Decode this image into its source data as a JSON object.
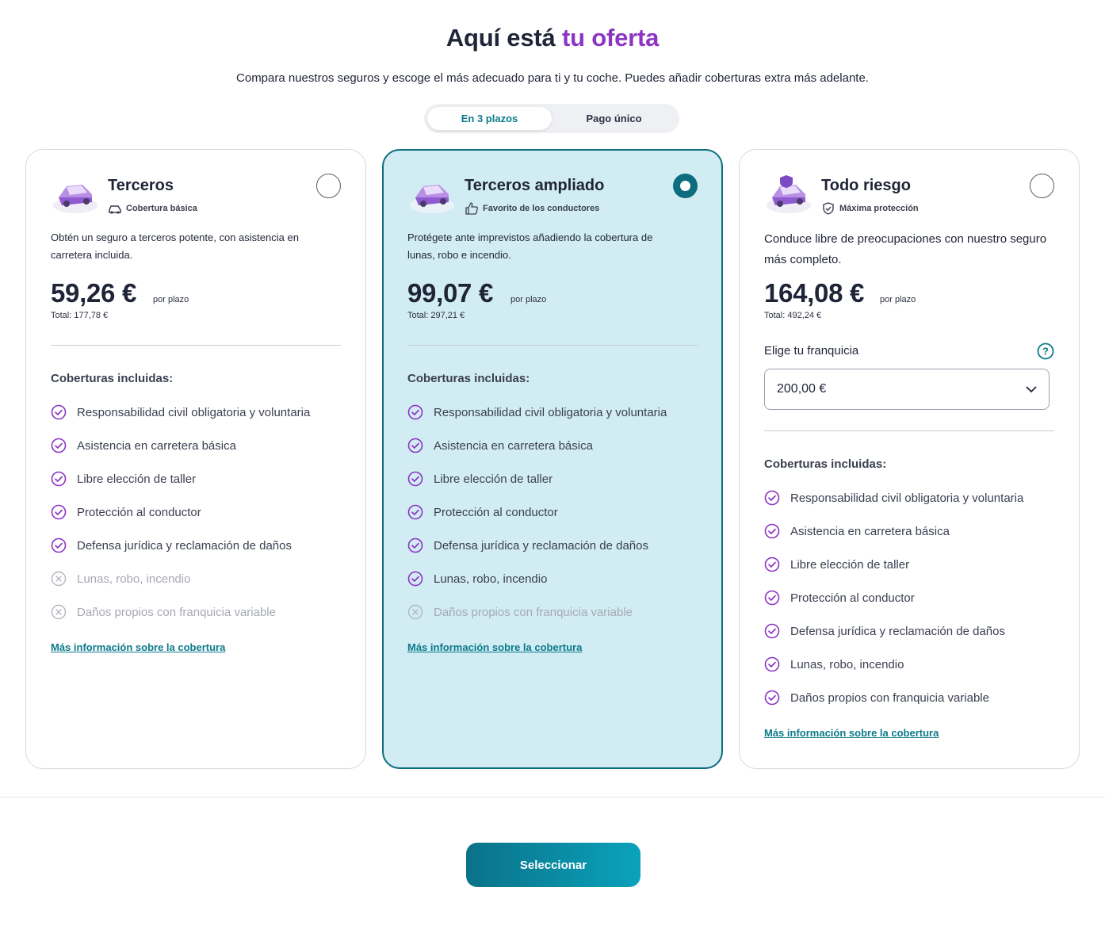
{
  "header": {
    "title_main": "Aquí está",
    "title_accent": "tu oferta",
    "subtitle": "Compara nuestros seguros y escoge el más adecuado para ti y tu coche. Puedes añadir coberturas extra más adelante."
  },
  "payment_toggle": {
    "options": [
      "En 3 plazos",
      "Pago único"
    ],
    "selected": "En 3 plazos"
  },
  "colors": {
    "accent_purple": "#8c35c4",
    "brand_teal": "#0d6d7e",
    "selected_card_bg": "#d1ecf3"
  },
  "plans": [
    {
      "name": "Terceros",
      "tag": "Cobertura básica",
      "tag_icon": "car-icon",
      "selected": false,
      "description": "Obtén un seguro a terceros potente, con asistencia en carretera incluida.",
      "price": "59,26 €",
      "per": "por plazo",
      "total": "Total: 177,78 €",
      "coverages_title": "Coberturas incluidas:",
      "coverages": [
        {
          "label": "Responsabilidad civil obligatoria y voluntaria",
          "included": true
        },
        {
          "label": "Asistencia en carretera básica",
          "included": true
        },
        {
          "label": "Libre elección de taller",
          "included": true
        },
        {
          "label": "Protección al conductor",
          "included": true
        },
        {
          "label": "Defensa jurídica y reclamación de daños",
          "included": true
        },
        {
          "label": "Lunas, robo, incendio",
          "included": false
        },
        {
          "label": "Daños propios con franquicia variable",
          "included": false
        }
      ],
      "more_link": "Más información sobre la cobertura"
    },
    {
      "name": "Terceros ampliado",
      "tag": "Favorito de los conductores",
      "tag_icon": "thumbs-up-icon",
      "selected": true,
      "description": "Protégete ante imprevistos añadiendo la cobertura de lunas, robo e incendio.",
      "price": "99,07 €",
      "per": "por plazo",
      "total": "Total: 297,21 €",
      "coverages_title": "Coberturas incluidas:",
      "coverages": [
        {
          "label": "Responsabilidad civil obligatoria y voluntaria",
          "included": true
        },
        {
          "label": "Asistencia en carretera básica",
          "included": true
        },
        {
          "label": "Libre elección de taller",
          "included": true
        },
        {
          "label": "Protección al conductor",
          "included": true
        },
        {
          "label": "Defensa jurídica y reclamación de daños",
          "included": true
        },
        {
          "label": "Lunas, robo, incendio",
          "included": true
        },
        {
          "label": "Daños propios con franquicia variable",
          "included": false
        }
      ],
      "more_link": "Más información sobre la cobertura"
    },
    {
      "name": "Todo riesgo",
      "tag": "Máxima protección",
      "tag_icon": "shield-check-icon",
      "selected": false,
      "description": "Conduce libre de preocupaciones con nuestro seguro más completo.",
      "price": "164,08 €",
      "per": "por plazo",
      "total": "Total: 492,24 €",
      "franchise_label": "Elige tu franquicia",
      "franchise_value": "200,00 €",
      "coverages_title": "Coberturas incluidas:",
      "coverages": [
        {
          "label": "Responsabilidad civil obligatoria y voluntaria",
          "included": true
        },
        {
          "label": "Asistencia en carretera básica",
          "included": true
        },
        {
          "label": "Libre elección de taller",
          "included": true
        },
        {
          "label": "Protección al conductor",
          "included": true
        },
        {
          "label": "Defensa jurídica y reclamación de daños",
          "included": true
        },
        {
          "label": "Lunas, robo, incendio",
          "included": true
        },
        {
          "label": "Daños propios con franquicia variable",
          "included": true
        }
      ],
      "more_link": "Más información sobre la cobertura"
    }
  ],
  "cta": {
    "label": "Seleccionar"
  }
}
